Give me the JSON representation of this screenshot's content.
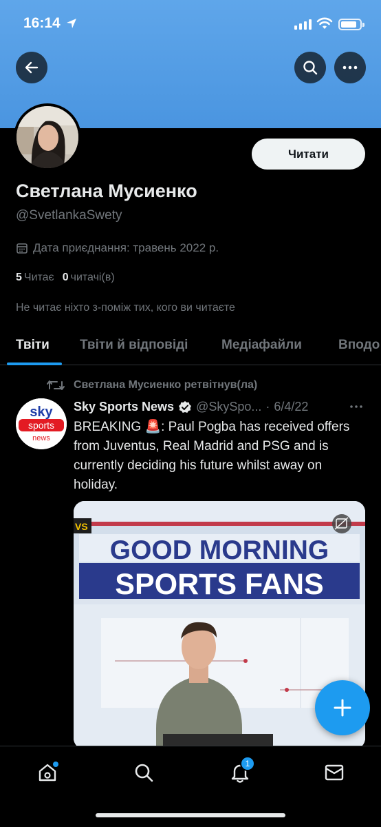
{
  "status_bar": {
    "time": "16:14"
  },
  "header": {
    "back_icon": "arrow-left-icon",
    "search_icon": "search-icon",
    "more_icon": "more-horizontal-icon",
    "banner_color": "#4a95e0"
  },
  "profile": {
    "follow_label": "Читати",
    "display_name": "Светлана Мусиенко",
    "handle": "@SvetlankaSwety",
    "joined": "Дата приєднання: травень 2022 р.",
    "following_count": "5",
    "following_label": "Читає",
    "followers_count": "0",
    "followers_label": "читачі(в)",
    "mutual_text": "Не читає ніхто з-поміж тих, кого ви читаєте"
  },
  "tabs": [
    {
      "label": "Твіти",
      "active": true
    },
    {
      "label": "Твіти й відповіді",
      "active": false
    },
    {
      "label": "Медіафайли",
      "active": false
    },
    {
      "label": "Вподо",
      "active": false
    }
  ],
  "tweet": {
    "retweet_label": "Светлана Мусиенко ретвітнув(ла)",
    "author": "Sky Sports News",
    "handle": "@SkySpo...",
    "separator": "·",
    "date": "6/4/22",
    "text": "BREAKING 🚨: Paul Pogba has received offers from Juventus, Real Madrid and PSG and is currently deciding his future whilst away on holiday.",
    "avatar_logo": {
      "line1": "sky",
      "line2": "sports",
      "line3": "news"
    },
    "media": {
      "line1": "GOOD MORNING",
      "line2": "SPORTS FANS",
      "tag": "VS"
    }
  },
  "bottom_nav": {
    "items": [
      "home-icon",
      "search-icon",
      "bell-icon",
      "mail-icon"
    ],
    "notif_badge": "1"
  },
  "colors": {
    "accent": "#1d9bf0",
    "background": "#000000",
    "muted": "#71767b"
  }
}
